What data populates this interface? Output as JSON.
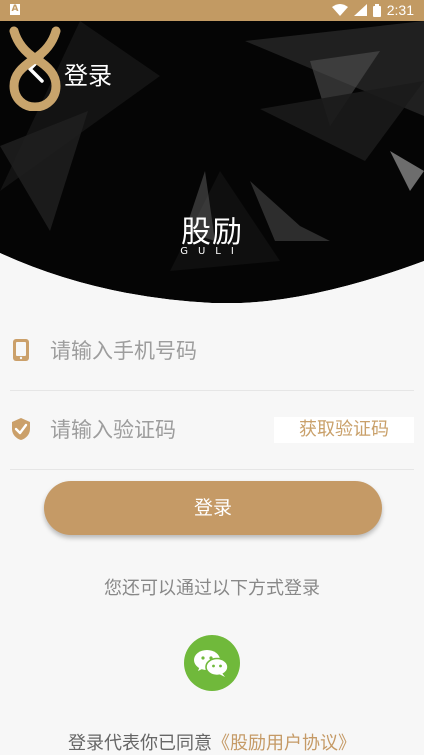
{
  "status_bar": {
    "left_icon": "A",
    "time": "2:31",
    "icons": [
      "wifi-icon",
      "signal-icon",
      "battery-icon"
    ]
  },
  "header": {
    "back_icon": "chevron-left-icon",
    "title": "登录"
  },
  "brand": {
    "name": "股励",
    "subtitle": "GULI",
    "logo_color": "#c8a46c"
  },
  "form": {
    "phone_placeholder": "请输入手机号码",
    "phone_value": "",
    "code_placeholder": "请输入验证码",
    "code_value": "",
    "get_code_label": "获取验证码",
    "login_label": "登录"
  },
  "alternatives": {
    "text": "您还可以通过以下方式登录",
    "wechat_icon": "wechat-icon"
  },
  "agreement": {
    "prefix": "登录代表你已同意",
    "link": "《股励用户协议》"
  },
  "colors": {
    "accent": "#c59a66",
    "status_bar": "#c29a63",
    "wechat": "#70b93b",
    "hero": "#050505"
  }
}
